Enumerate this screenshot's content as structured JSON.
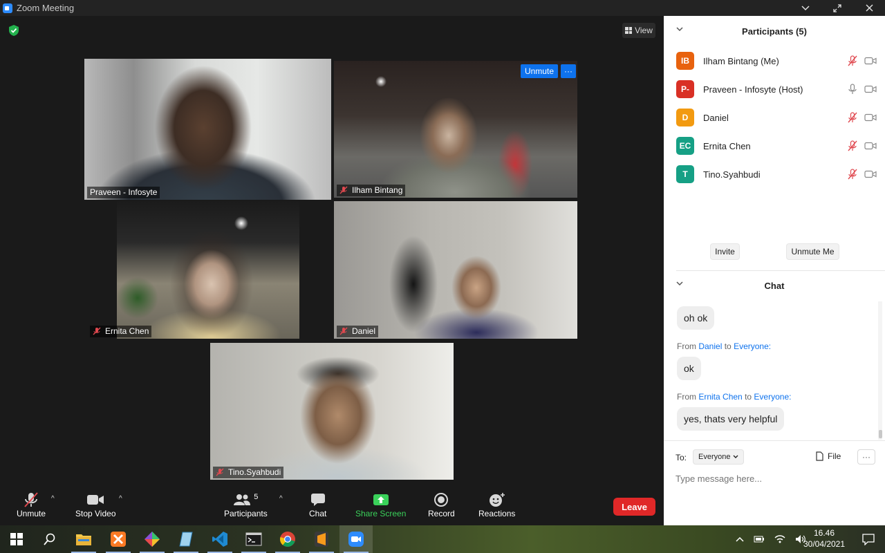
{
  "window": {
    "title": "Zoom Meeting"
  },
  "stage": {
    "view_label": "View"
  },
  "tiles": {
    "praveen": {
      "name": "Praveen - Infosyte"
    },
    "ilham": {
      "name": "Ilham Bintang",
      "unmute_label": "Unmute",
      "more_label": "···"
    },
    "ernita": {
      "name": "Ernita Chen"
    },
    "daniel": {
      "name": "Daniel"
    },
    "tino": {
      "name": "Tino.Syahbudi"
    }
  },
  "toolbar": {
    "unmute": "Unmute",
    "stop_video": "Stop Video",
    "participants": "Participants",
    "participants_count": "5",
    "chat": "Chat",
    "share_screen": "Share Screen",
    "record": "Record",
    "reactions": "Reactions",
    "leave": "Leave"
  },
  "participants_panel": {
    "title": "Participants (5)",
    "items": [
      {
        "initials": "IB",
        "name": "Ilham Bintang (Me)",
        "color": "#e8620e",
        "muted": true
      },
      {
        "initials": "P-",
        "name": "Praveen - Infosyte (Host)",
        "color": "#d93025",
        "muted": false
      },
      {
        "initials": "D",
        "name": "Daniel",
        "color": "#f29a10",
        "muted": true
      },
      {
        "initials": "EC",
        "name": "Ernita Chen",
        "color": "#16a085",
        "muted": true
      },
      {
        "initials": "T",
        "name": "Tino.Syahbudi",
        "color": "#16a085",
        "muted": true
      }
    ],
    "invite_label": "Invite",
    "unmute_me_label": "Unmute Me"
  },
  "chat_panel": {
    "title": "Chat",
    "messages": [
      {
        "text": "oh ok"
      },
      {
        "from_prefix": "From",
        "from": "Daniel",
        "to_word": "to",
        "to": "Everyone:",
        "text": "ok"
      },
      {
        "from_prefix": "From",
        "from": "Ernita Chen",
        "to_word": "to",
        "to": "Everyone:",
        "text": "yes, thats very helpful"
      }
    ],
    "to_label": "To:",
    "recipient": "Everyone",
    "file_label": "File",
    "more_label": "···",
    "input_placeholder": "Type message here..."
  },
  "taskbar": {
    "apps": [
      "windows-start",
      "search",
      "file-explorer",
      "xampp",
      "git-kraken",
      "notepad",
      "vscode",
      "terminal",
      "chrome",
      "sublime-text",
      "zoom"
    ],
    "time": "16.46",
    "date": "30/04/2021"
  },
  "colors": {
    "zoom_blue": "#0e72ed",
    "leave_red": "#e02828",
    "share_green": "#3ad15a",
    "active_speaker": "#c7e34a",
    "muted_red": "#e0484f"
  }
}
